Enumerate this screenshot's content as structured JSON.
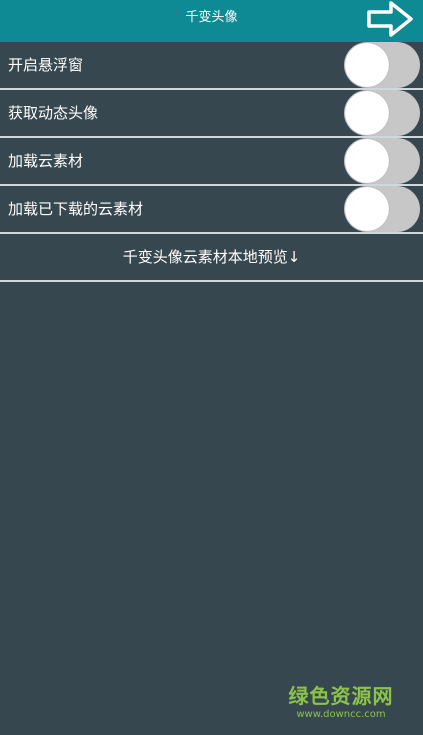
{
  "header": {
    "title": "千变头像",
    "next_icon": "arrow-right-icon"
  },
  "settings": [
    {
      "label": "开启悬浮窗",
      "enabled": false
    },
    {
      "label": "获取动态头像",
      "enabled": false
    },
    {
      "label": "加载云素材",
      "enabled": false
    },
    {
      "label": "加载已下载的云素材",
      "enabled": false
    }
  ],
  "preview": {
    "label": "千变头像云素材本地预览↓"
  },
  "watermark": {
    "main": "绿色资源网",
    "sub": "www.downcc.com"
  },
  "colors": {
    "header_bg": "#0d8a93",
    "page_bg": "#37474f",
    "toggle_off": "#c7c7c7",
    "watermark": "#8bc34a"
  }
}
